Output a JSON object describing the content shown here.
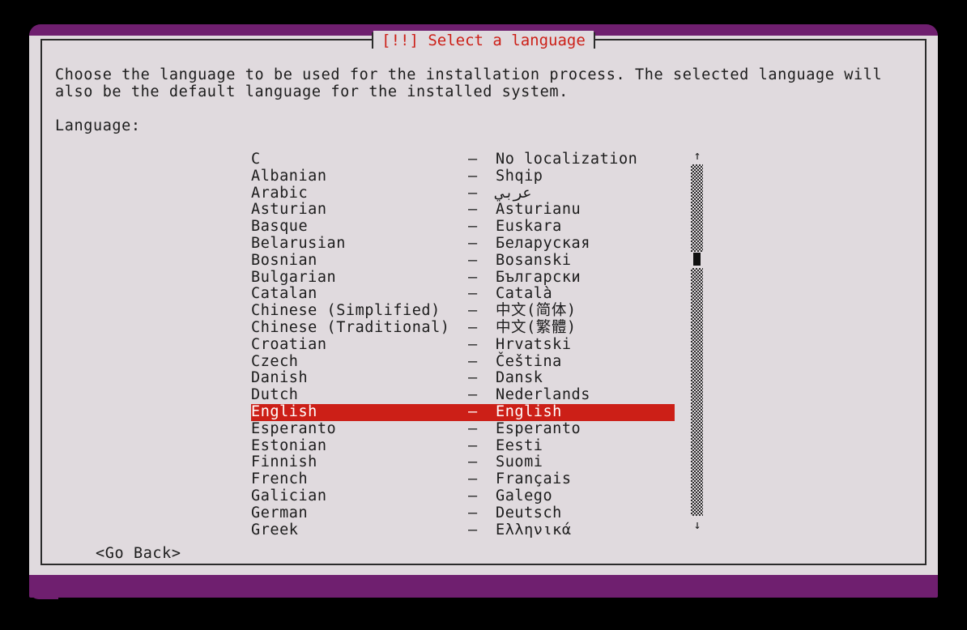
{
  "window": {
    "frame_color": "#6f1f6f",
    "surface_color": "#e0dade",
    "border_color": "#2b2b2b"
  },
  "dialog": {
    "title": "[!!] Select a language",
    "title_color": "#cc1f17",
    "intro_line_1": "Choose the language to be used for the installation process. The selected language will",
    "intro_line_2": "also be the default language for the installed system.",
    "field_label": "Language:"
  },
  "list": {
    "separator": "–",
    "selected_index": 15,
    "highlight_bg": "#cc1f17",
    "highlight_fg": "#ffffff",
    "items": [
      {
        "name": "C",
        "native": "No localization"
      },
      {
        "name": "Albanian",
        "native": "Shqip"
      },
      {
        "name": "Arabic",
        "native": "عربي"
      },
      {
        "name": "Asturian",
        "native": "Asturianu"
      },
      {
        "name": "Basque",
        "native": "Euskara"
      },
      {
        "name": "Belarusian",
        "native": "Беларуская"
      },
      {
        "name": "Bosnian",
        "native": "Bosanski"
      },
      {
        "name": "Bulgarian",
        "native": "Български"
      },
      {
        "name": "Catalan",
        "native": "Català"
      },
      {
        "name": "Chinese (Simplified)",
        "native": "中文(简体)"
      },
      {
        "name": "Chinese (Traditional)",
        "native": "中文(繁體)"
      },
      {
        "name": "Croatian",
        "native": "Hrvatski"
      },
      {
        "name": "Czech",
        "native": "Čeština"
      },
      {
        "name": "Danish",
        "native": "Dansk"
      },
      {
        "name": "Dutch",
        "native": "Nederlands"
      },
      {
        "name": "English",
        "native": "English"
      },
      {
        "name": "Esperanto",
        "native": "Esperanto"
      },
      {
        "name": "Estonian",
        "native": "Eesti"
      },
      {
        "name": "Finnish",
        "native": "Suomi"
      },
      {
        "name": "French",
        "native": "Français"
      },
      {
        "name": "Galician",
        "native": "Galego"
      },
      {
        "name": "German",
        "native": "Deutsch"
      },
      {
        "name": "Greek",
        "native": "Ελληνικά"
      }
    ]
  },
  "scrollbar": {
    "arrow_up": "↑",
    "arrow_down": "↓"
  },
  "buttons": {
    "go_back": "<Go Back>"
  }
}
